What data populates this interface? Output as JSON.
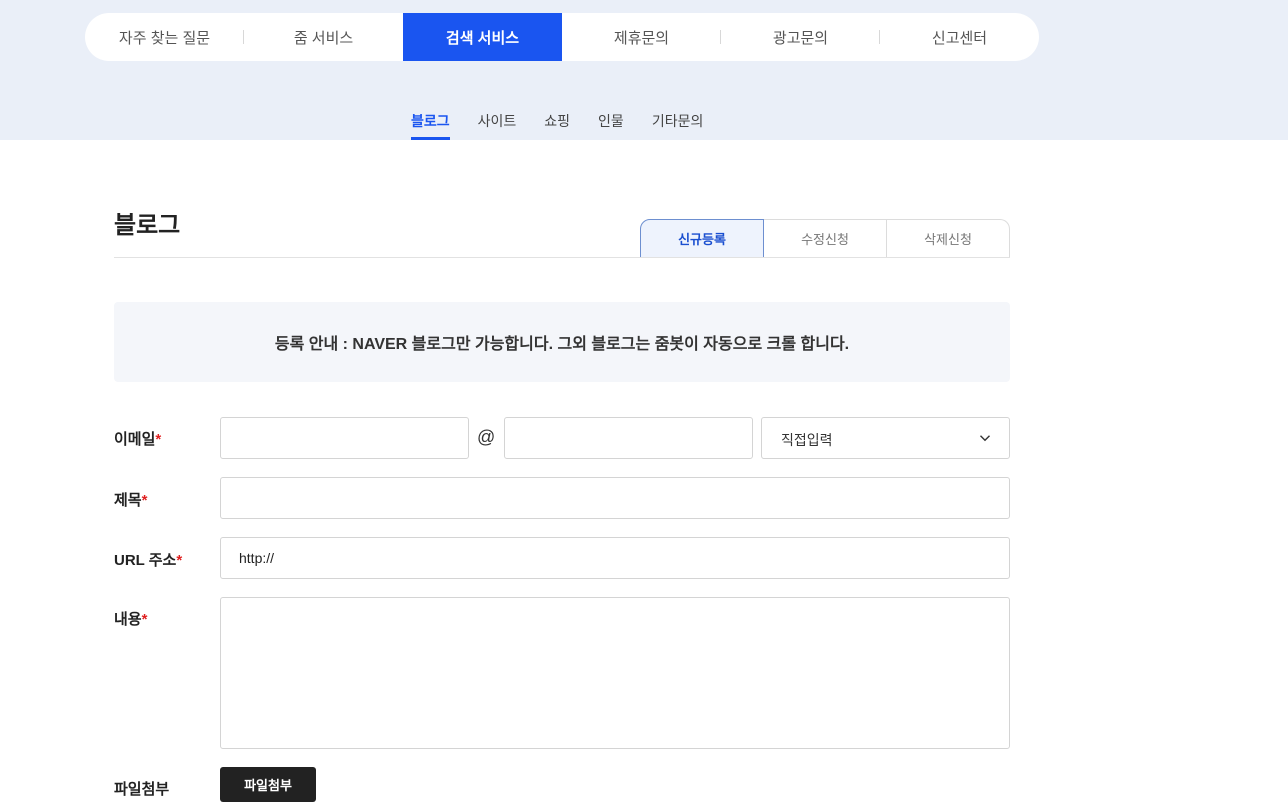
{
  "main_tabs": [
    {
      "label": "자주 찾는 질문"
    },
    {
      "label": "줌 서비스"
    },
    {
      "label": "검색 서비스",
      "active": true
    },
    {
      "label": "제휴문의"
    },
    {
      "label": "광고문의"
    },
    {
      "label": "신고센터"
    }
  ],
  "sub_tabs": [
    {
      "label": "블로그",
      "active": true
    },
    {
      "label": "사이트"
    },
    {
      "label": "쇼핑"
    },
    {
      "label": "인물"
    },
    {
      "label": "기타문의"
    }
  ],
  "page_title": "블로그",
  "reg_tabs": [
    {
      "label": "신규등록",
      "active": true
    },
    {
      "label": "수정신청"
    },
    {
      "label": "삭제신청"
    }
  ],
  "notice": "등록 안내 : NAVER 블로그만 가능합니다. 그외 블로그는 줌봇이 자동으로 크롤 합니다.",
  "form": {
    "required_mark": "*",
    "email_label": "이메일",
    "email_local_value": "",
    "at_sign": "@",
    "email_domain_value": "",
    "email_domain_select": "직접입력",
    "title_label": "제목",
    "title_value": "",
    "url_label": "URL 주소",
    "url_value": "http://",
    "content_label": "내용",
    "content_value": "",
    "file_label": "파일첨부",
    "file_button": "파일첨부"
  },
  "colors": {
    "accent": "#1a55f0",
    "band": "#eaeff8",
    "required": "#e02020"
  },
  "icons": {
    "select_arrow": "chevron-down-icon"
  }
}
